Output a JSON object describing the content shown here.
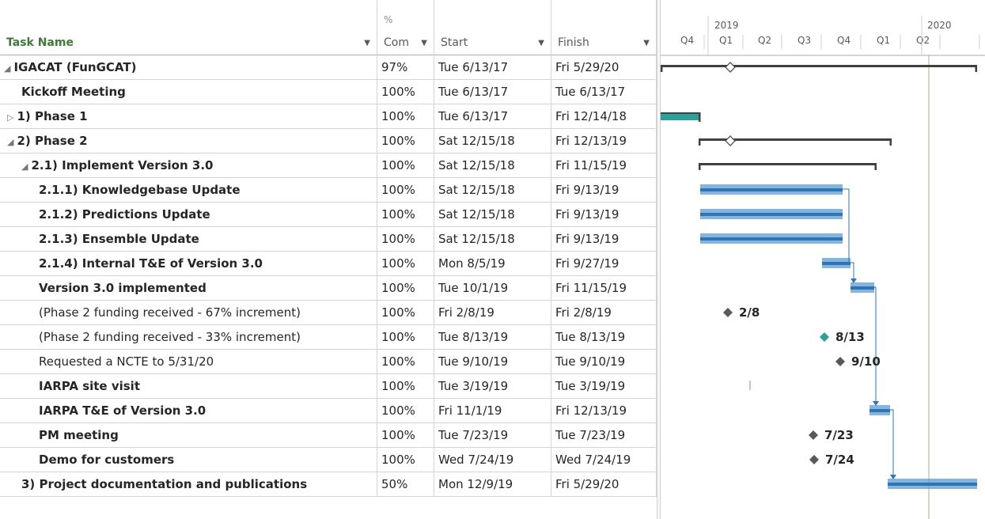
{
  "columns": {
    "task_name": "Task Name",
    "pct_top": "%",
    "pct": "Com",
    "start": "Start",
    "finish": "Finish"
  },
  "timeline": {
    "years": [
      "2019",
      "2020"
    ],
    "quarters": [
      "Q4",
      "Q1",
      "Q2",
      "Q3",
      "Q4",
      "Q1",
      "Q2"
    ]
  },
  "tasks": [
    {
      "name": "IGACAT (FunGCAT)",
      "toggle": "◢",
      "pct": "97%",
      "start": "Tue 6/13/17",
      "finish": "Fri 5/29/20",
      "bold": true
    },
    {
      "name": "Kickoff Meeting",
      "toggle": "",
      "pct": "100%",
      "start": "Tue 6/13/17",
      "finish": "Tue 6/13/17",
      "bold": true
    },
    {
      "name": "1) Phase 1",
      "toggle": "▷",
      "pct": "100%",
      "start": "Tue 6/13/17",
      "finish": "Fri 12/14/18",
      "bold": true
    },
    {
      "name": "2) Phase 2",
      "toggle": "◢",
      "pct": "100%",
      "start": "Sat 12/15/18",
      "finish": "Fri 12/13/19",
      "bold": true
    },
    {
      "name": "2.1) Implement Version 3.0",
      "toggle": "◢",
      "pct": "100%",
      "start": "Sat 12/15/18",
      "finish": "Fri 11/15/19",
      "bold": true
    },
    {
      "name": "2.1.1) Knowledgebase Update",
      "toggle": "",
      "pct": "100%",
      "start": "Sat 12/15/18",
      "finish": "Fri 9/13/19",
      "bold": true
    },
    {
      "name": "2.1.2) Predictions Update",
      "toggle": "",
      "pct": "100%",
      "start": "Sat 12/15/18",
      "finish": "Fri 9/13/19",
      "bold": true
    },
    {
      "name": "2.1.3) Ensemble Update",
      "toggle": "",
      "pct": "100%",
      "start": "Sat 12/15/18",
      "finish": "Fri 9/13/19",
      "bold": true
    },
    {
      "name": "2.1.4) Internal T&E of Version 3.0",
      "toggle": "",
      "pct": "100%",
      "start": "Mon 8/5/19",
      "finish": "Fri 9/27/19",
      "bold": true
    },
    {
      "name": "Version 3.0 implemented",
      "toggle": "",
      "pct": "100%",
      "start": "Tue 10/1/19",
      "finish": "Fri 11/15/19",
      "bold": true
    },
    {
      "name": "(Phase 2 funding received - 67% increment)",
      "toggle": "",
      "pct": "100%",
      "start": "Fri 2/8/19",
      "finish": "Fri 2/8/19",
      "bold": false
    },
    {
      "name": "(Phase 2 funding received - 33% increment)",
      "toggle": "",
      "pct": "100%",
      "start": "Tue 8/13/19",
      "finish": "Tue 8/13/19",
      "bold": false
    },
    {
      "name": "Requested a NCTE to 5/31/20",
      "toggle": "",
      "pct": "100%",
      "start": "Tue 9/10/19",
      "finish": "Tue 9/10/19",
      "bold": false
    },
    {
      "name": "IARPA site visit",
      "toggle": "",
      "pct": "100%",
      "start": "Tue 3/19/19",
      "finish": "Tue 3/19/19",
      "bold": true
    },
    {
      "name": "IARPA T&E of Version 3.0",
      "toggle": "",
      "pct": "100%",
      "start": "Fri 11/1/19",
      "finish": "Fri 12/13/19",
      "bold": true
    },
    {
      "name": "PM meeting",
      "toggle": "",
      "pct": "100%",
      "start": "Tue 7/23/19",
      "finish": "Tue 7/23/19",
      "bold": true
    },
    {
      "name": "Demo for customers",
      "toggle": "",
      "pct": "100%",
      "start": "Wed 7/24/19",
      "finish": "Wed 7/24/19",
      "bold": true
    },
    {
      "name": "3) Project documentation and publications",
      "toggle": "",
      "pct": "50%",
      "start": "Mon 12/9/19",
      "finish": "Fri 5/29/20",
      "bold": true
    }
  ],
  "milestone_labels": [
    "2/8",
    "8/13",
    "9/10",
    "7/23",
    "7/24"
  ],
  "colors": {
    "task_header": "#3c7a36",
    "bar": "#5b9bd5",
    "bar_progress": "#2e75b6",
    "summary": "#404040",
    "phase1_bar": "#2aa19a",
    "milestone": "#595959",
    "milestone_teal": "#2aa19a",
    "today_line": "#8fbf7a"
  }
}
